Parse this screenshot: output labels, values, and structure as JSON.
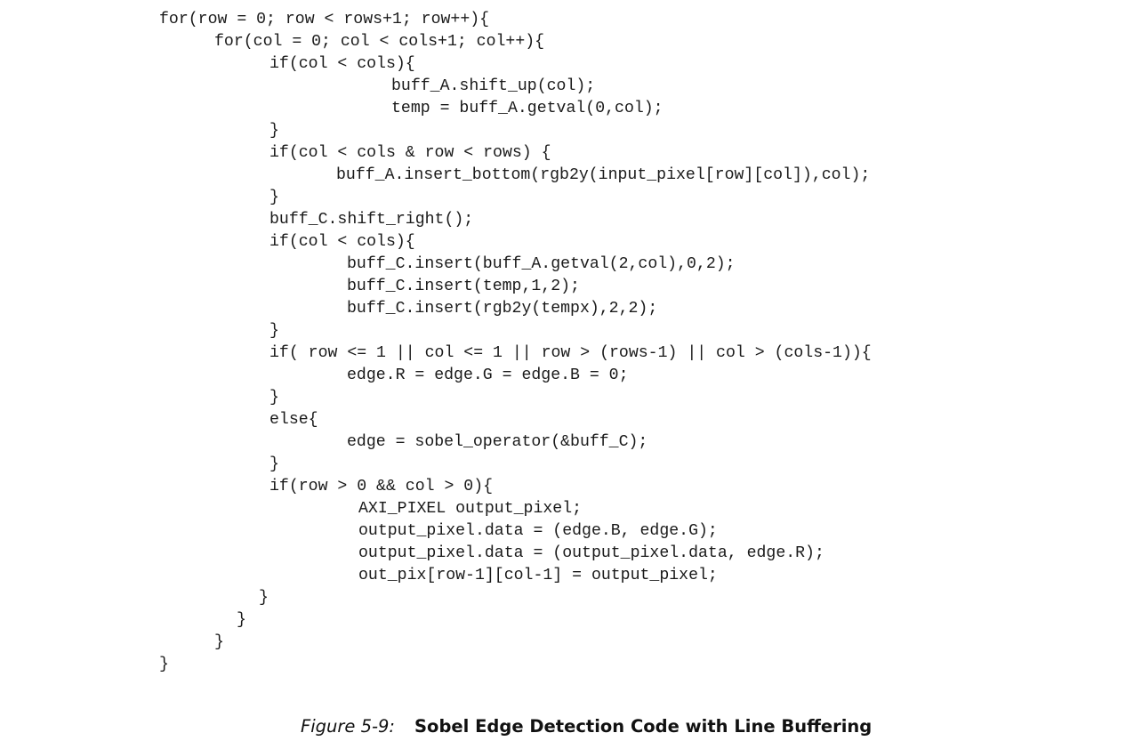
{
  "code": {
    "lines": [
      "for(row = 0; row < rows+1; row++){",
      "for(col = 0; col < cols+1; col++){",
      "if(col < cols){",
      "buff_A.shift_up(col);",
      "temp = buff_A.getval(0,col);",
      "}",
      "if(col < cols & row < rows) {",
      "buff_A.insert_bottom(rgb2y(input_pixel[row][col]),col);",
      "}",
      "buff_C.shift_right();",
      "if(col < cols){",
      "buff_C.insert(buff_A.getval(2,col),0,2);",
      "buff_C.insert(temp,1,2);",
      "buff_C.insert(rgb2y(tempx),2,2);",
      "}",
      "if( row <= 1 || col <= 1 || row > (rows-1) || col > (cols-1)){",
      "edge.R = edge.G = edge.B = 0;",
      "}",
      "else{",
      "edge = sobel_operator(&buff_C);",
      "}",
      "if(row > 0 && col > 0){",
      "AXI_PIXEL output_pixel;",
      "output_pixel.data = (edge.B, edge.G);",
      "output_pixel.data = (output_pixel.data, edge.R);",
      "out_pix[row-1][col-1] = output_pixel;",
      "}",
      "}",
      "}",
      "}"
    ]
  },
  "caption": {
    "label": "Figure 5-9:",
    "title": "Sobel Edge Detection Code with Line Buffering"
  }
}
